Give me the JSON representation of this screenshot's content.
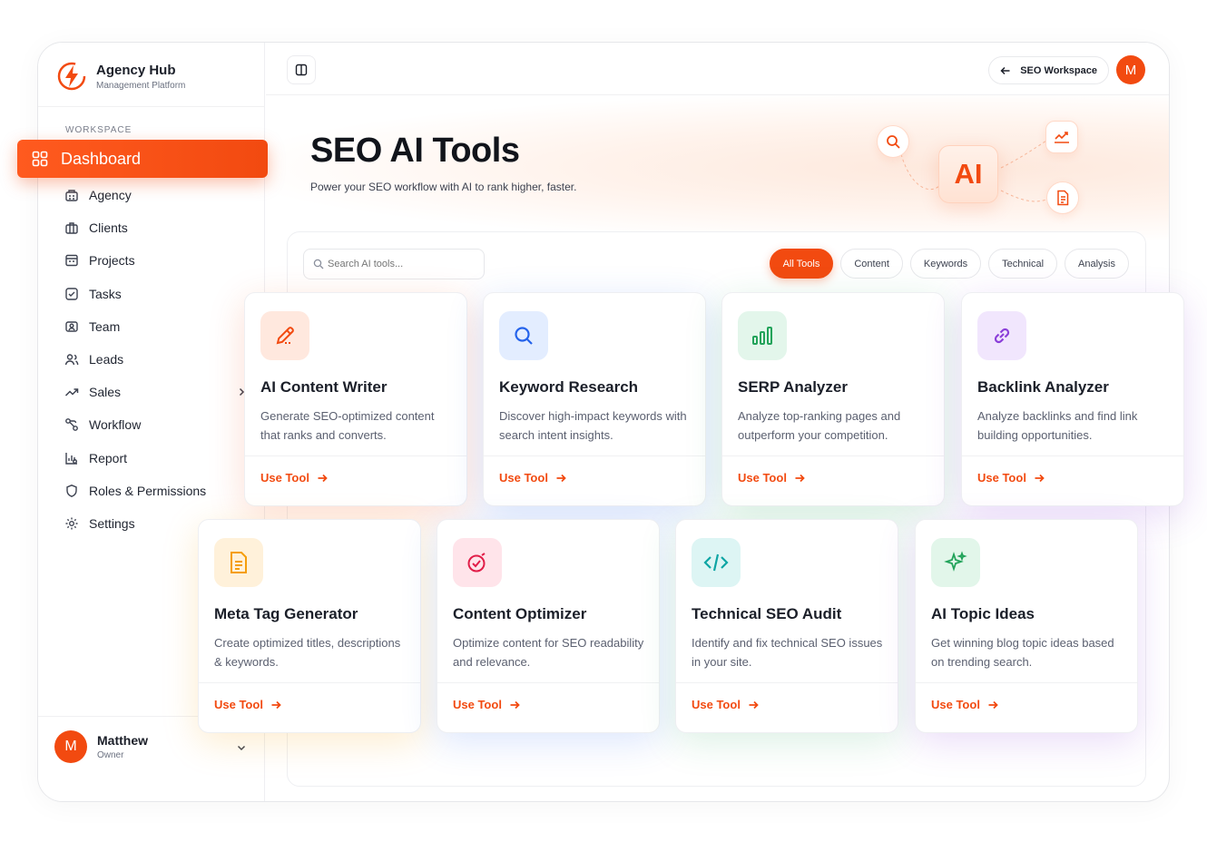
{
  "brand": {
    "name": "Agency Hub",
    "subtitle": "Management Platform"
  },
  "sidebar": {
    "section_label": "WORKSPACE",
    "active_item": {
      "label": "Dashboard",
      "icon": "grid-icon"
    },
    "items": [
      {
        "label": "Agency",
        "icon": "building-icon"
      },
      {
        "label": "Clients",
        "icon": "briefcase-icon"
      },
      {
        "label": "Projects",
        "icon": "projects-icon"
      },
      {
        "label": "Tasks",
        "icon": "checkbox-icon"
      },
      {
        "label": "Team",
        "icon": "team-icon"
      },
      {
        "label": "Leads",
        "icon": "users-icon"
      },
      {
        "label": "Sales",
        "icon": "trending-icon"
      },
      {
        "label": "Workflow",
        "icon": "workflow-icon"
      },
      {
        "label": "Report",
        "icon": "report-icon"
      },
      {
        "label": "Roles & Permissions",
        "icon": "shield-icon"
      },
      {
        "label": "Settings",
        "icon": "gear-icon"
      }
    ],
    "user": {
      "initial": "M",
      "name": "Matthew",
      "role": "Owner"
    }
  },
  "topbar": {
    "workspace_label": "SEO Workspace",
    "avatar_initial": "M"
  },
  "hero": {
    "title": "SEO AI Tools",
    "subtitle": "Power your SEO workflow with AI to rank higher, faster.",
    "badge": "AI"
  },
  "search": {
    "placeholder": "Search AI tools..."
  },
  "filters": [
    "All Tools",
    "Content",
    "Keywords",
    "Technical",
    "Analysis"
  ],
  "cta_label": "Use Tool",
  "tools": [
    {
      "title": "AI Content Writer",
      "description": "Generate SEO-optimized content that ranks and converts.",
      "icon": "pencil-icon",
      "accent": "#f24a10"
    },
    {
      "title": "Keyword Research",
      "description": "Discover high-impact keywords with search intent insights.",
      "icon": "search-icon",
      "accent": "#2563eb"
    },
    {
      "title": "SERP Analyzer",
      "description": "Analyze top-ranking pages and outperform your competition.",
      "icon": "bar-chart-icon",
      "accent": "#22a35a"
    },
    {
      "title": "Backlink Analyzer",
      "description": "Analyze backlinks and find link building opportunities.",
      "icon": "link-icon",
      "accent": "#8b3fd9"
    },
    {
      "title": "Meta Tag Generator",
      "description": "Create optimized titles, descriptions & keywords.",
      "icon": "document-icon",
      "accent": "#f59e0b"
    },
    {
      "title": "Content Optimizer",
      "description": "Optimize content for SEO readability and relevance.",
      "icon": "target-check-icon",
      "accent": "#e11d48"
    },
    {
      "title": "Technical SEO Audit",
      "description": "Identify and fix technical SEO issues in your site.",
      "icon": "code-icon",
      "accent": "#0ea5a4"
    },
    {
      "title": "AI Topic Ideas",
      "description": "Get winning blog topic ideas based on trending search.",
      "icon": "sparkle-icon",
      "accent": "#22a35a"
    }
  ]
}
